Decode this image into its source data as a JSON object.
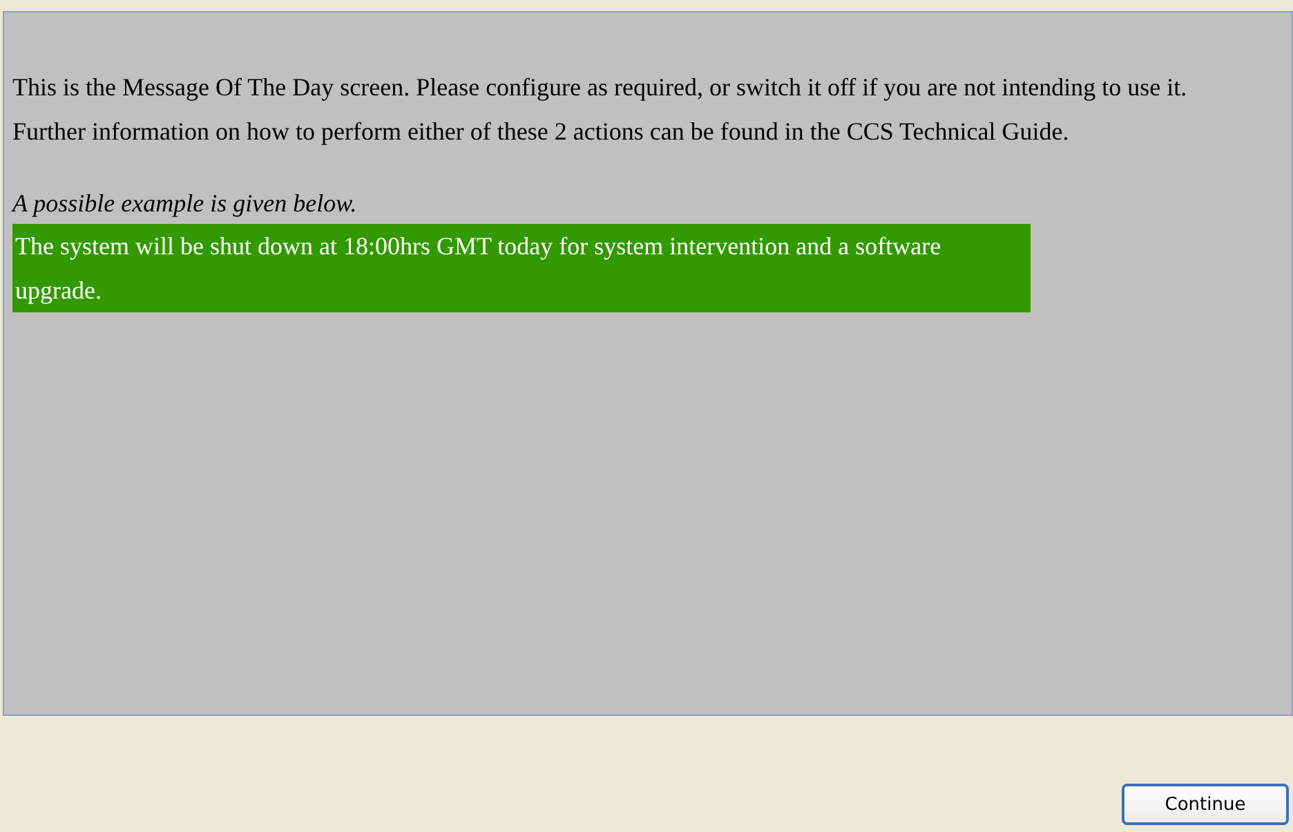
{
  "intro": [
    "This is the Message Of The Day screen. Please configure as required, or switch it off if you are not intending to use it.",
    "Further information on how to perform either of these 2 actions can be found in the CCS Technical Guide."
  ],
  "example_caption": "A possible example is given below.",
  "example_message": "The system will be shut down at 18:00hrs GMT today for system intervention and a software upgrade.",
  "buttons": [
    {
      "label": "Continue"
    }
  ]
}
